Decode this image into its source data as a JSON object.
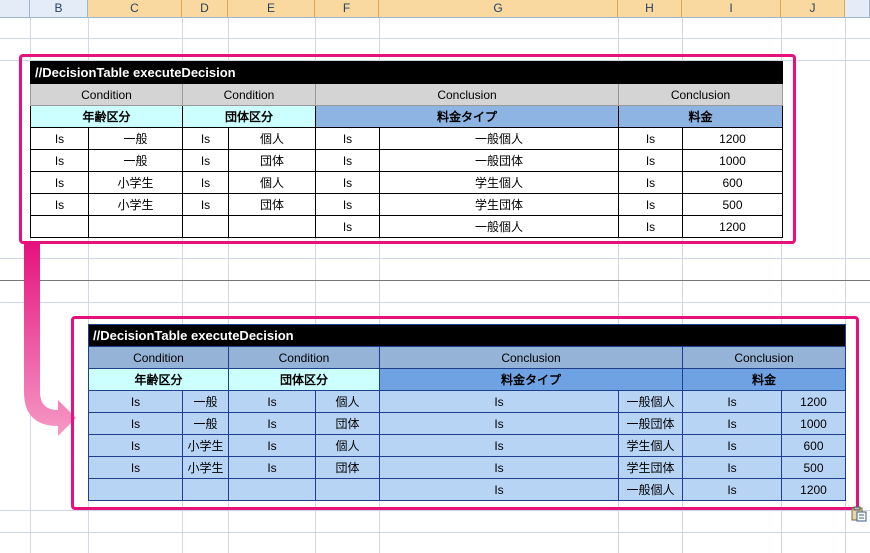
{
  "spreadsheet": {
    "columns": [
      "B",
      "C",
      "D",
      "E",
      "F",
      "G",
      "H",
      "I",
      "J"
    ]
  },
  "table_before": {
    "title": "//DecisionTable executeDecision",
    "type_row": [
      "Condition",
      "Condition",
      "Conclusion",
      "Conclusion"
    ],
    "name_row": [
      "年齢区分",
      "団体区分",
      "料金タイプ",
      "料金"
    ],
    "rows": [
      [
        "Is",
        "一般",
        "Is",
        "個人",
        "Is",
        "一般個人",
        "Is",
        "1200"
      ],
      [
        "Is",
        "一般",
        "Is",
        "団体",
        "Is",
        "一般団体",
        "Is",
        "1000"
      ],
      [
        "Is",
        "小学生",
        "Is",
        "個人",
        "Is",
        "学生個人",
        "Is",
        "600"
      ],
      [
        "Is",
        "小学生",
        "Is",
        "団体",
        "Is",
        "学生団体",
        "Is",
        "500"
      ],
      [
        "",
        "",
        "",
        "",
        "Is",
        "一般個人",
        "Is",
        "1200"
      ]
    ]
  },
  "table_after": {
    "title": "//DecisionTable executeDecision",
    "type_row": [
      "Condition",
      "Condition",
      "Conclusion",
      "Conclusion"
    ],
    "name_row": [
      "年齢区分",
      "団体区分",
      "料金タイプ",
      "料金"
    ],
    "rows": [
      [
        "Is",
        "一般",
        "Is",
        "個人",
        "Is",
        "一般個人",
        "Is",
        "1200"
      ],
      [
        "Is",
        "一般",
        "Is",
        "団体",
        "Is",
        "一般団体",
        "Is",
        "1000"
      ],
      [
        "Is",
        "小学生",
        "Is",
        "個人",
        "Is",
        "学生個人",
        "Is",
        "600"
      ],
      [
        "Is",
        "小学生",
        "Is",
        "団体",
        "Is",
        "学生団体",
        "Is",
        "500"
      ],
      [
        "",
        "",
        "",
        "",
        "Is",
        "一般個人",
        "Is",
        "1200"
      ]
    ]
  },
  "colors": {
    "highlight_frame": "#e5127d",
    "condition_header": "#ccffff",
    "conclusion_header": "#8db4e2"
  },
  "icons": {
    "arrow": "curved-arrow-icon",
    "paste_options": "paste-options-icon"
  }
}
